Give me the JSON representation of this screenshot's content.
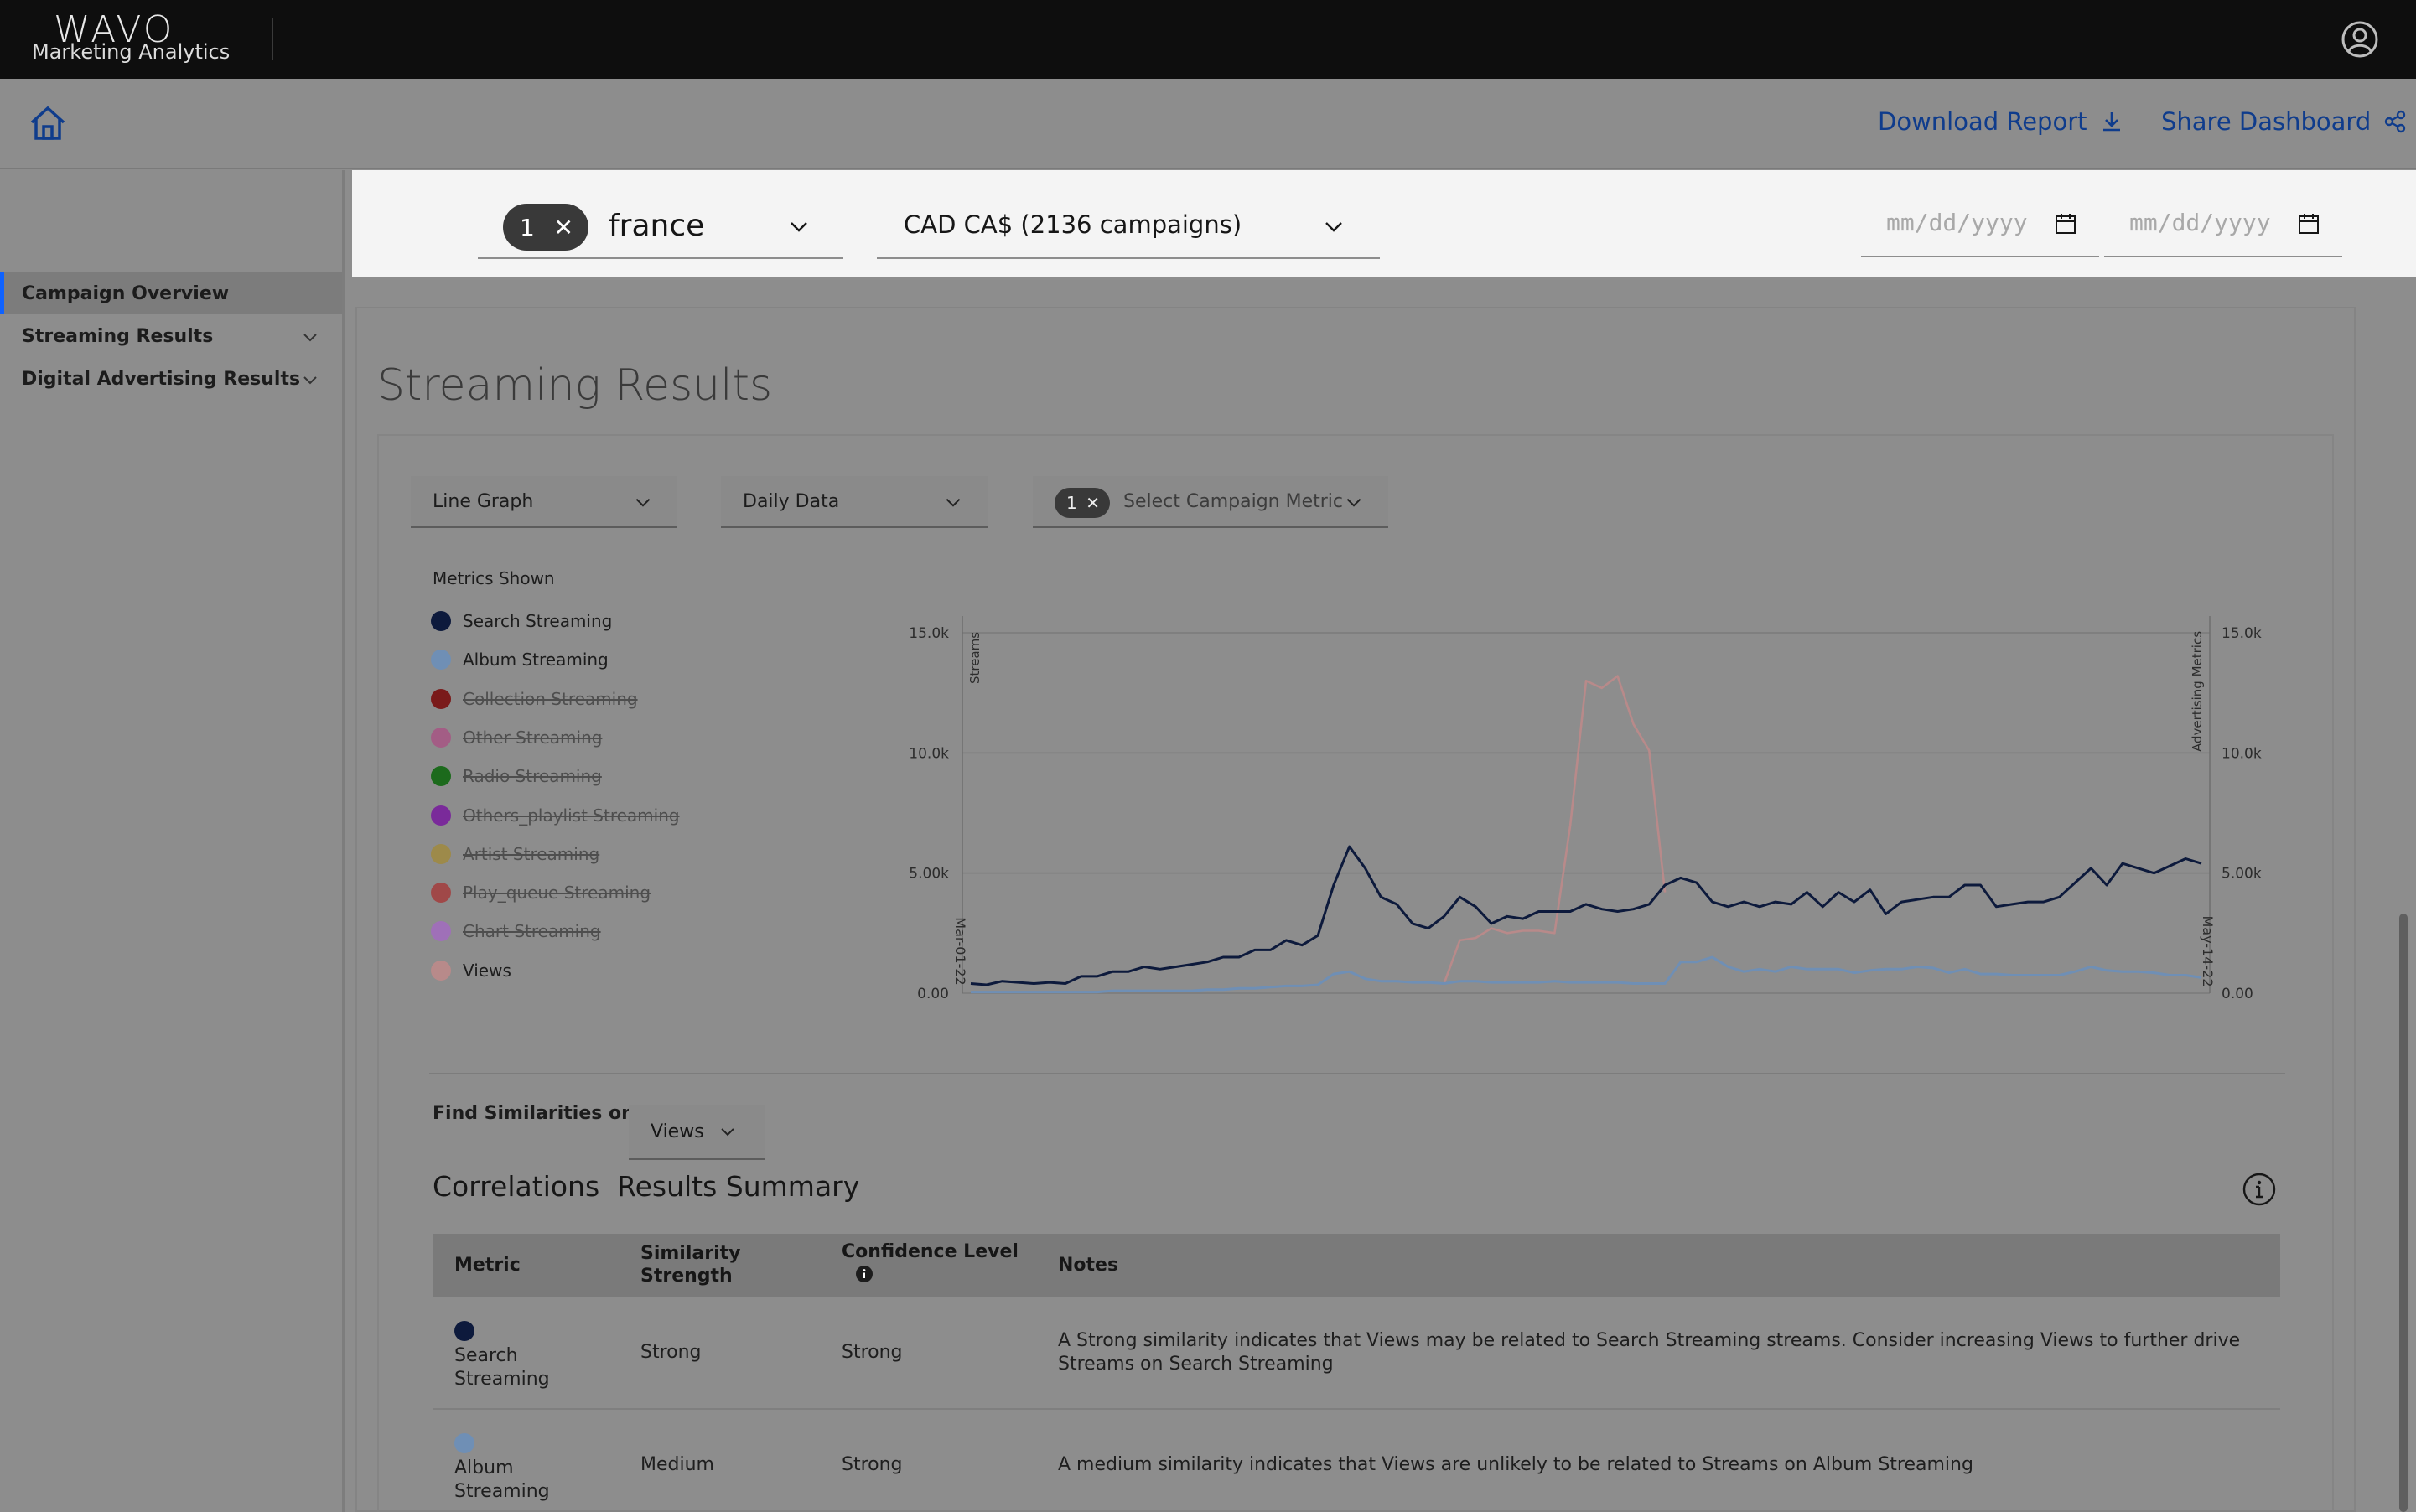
{
  "brand": {
    "logo": "WAVO",
    "subtitle": "Marketing Analytics"
  },
  "header": {
    "download_label": "Download Report",
    "share_label": "Share Dashboard"
  },
  "sidebar": {
    "items": [
      {
        "label": "Campaign Overview",
        "active": true
      },
      {
        "label": "Streaming Results",
        "expandable": true
      },
      {
        "label": "Digital Advertising Results",
        "expandable": true
      }
    ]
  },
  "filters": {
    "country_count": "1",
    "country_value": "france",
    "currency_value": "CAD CA$ (2136 campaigns)",
    "start_date_placeholder": "mm/dd/yyyy",
    "end_date_placeholder": "mm/dd/yyyy"
  },
  "section": {
    "title": "Streaming Results",
    "graph_type": "Line Graph",
    "data_granularity": "Daily Data",
    "metric_count": "1",
    "metric_placeholder": "Select Campaign Metric"
  },
  "legend": {
    "title": "Metrics Shown",
    "items": [
      {
        "label": "Search Streaming",
        "color": "#0d1a3c",
        "enabled": true
      },
      {
        "label": "Album Streaming",
        "color": "#6f8fb5",
        "enabled": true
      },
      {
        "label": "Collection Streaming",
        "color": "#7a1a1a",
        "enabled": false
      },
      {
        "label": "Other Streaming",
        "color": "#a35d85",
        "enabled": false
      },
      {
        "label": "Radio Streaming",
        "color": "#1c6a1c",
        "enabled": false
      },
      {
        "label": "Others_playlist Streaming",
        "color": "#7a2a9a",
        "enabled": false
      },
      {
        "label": "Artist Streaming",
        "color": "#9d8a4a",
        "enabled": false
      },
      {
        "label": "Play_queue Streaming",
        "color": "#a04848",
        "enabled": false
      },
      {
        "label": "Chart Streaming",
        "color": "#9f70b8",
        "enabled": false
      },
      {
        "label": "Views",
        "color": "#b88a8a",
        "enabled": true
      }
    ]
  },
  "chart_data": {
    "type": "line",
    "ylabel_left": "Streams",
    "ylabel_right": "Advertising Metrics",
    "ylim": [
      0,
      15000
    ],
    "y_ticks": [
      "0.00",
      "5.00k",
      "10.0k",
      "15.0k"
    ],
    "x_start_label": "Mar-01-22",
    "x_end_label": "May-14-22",
    "series": [
      {
        "name": "Search Streaming",
        "color": "#0d1a3c",
        "axis": "left",
        "values": [
          400,
          350,
          500,
          450,
          400,
          450,
          400,
          700,
          700,
          900,
          900,
          1100,
          1000,
          1100,
          1200,
          1300,
          1500,
          1500,
          1800,
          1800,
          2200,
          2000,
          2400,
          4500,
          6100,
          5200,
          4000,
          3700,
          2900,
          2700,
          3200,
          4000,
          3600,
          2900,
          3200,
          3100,
          3400,
          3400,
          3400,
          3700,
          3500,
          3400,
          3500,
          3700,
          4500,
          4800,
          4600,
          3800,
          3600,
          3800,
          3600,
          3800,
          3700,
          4200,
          3600,
          4200,
          3800,
          4300,
          3300,
          3800,
          3900,
          4000,
          4000,
          4500,
          4500,
          3600,
          3700,
          3800,
          3800,
          4000,
          4600,
          5200,
          4500,
          5400,
          5200,
          5000,
          5300,
          5600,
          5400
        ]
      },
      {
        "name": "Album Streaming",
        "color": "#6f8fb5",
        "axis": "left",
        "values": [
          50,
          50,
          50,
          50,
          50,
          50,
          50,
          50,
          50,
          100,
          100,
          100,
          100,
          100,
          100,
          150,
          150,
          200,
          200,
          250,
          300,
          300,
          350,
          800,
          900,
          600,
          500,
          500,
          450,
          450,
          400,
          500,
          500,
          450,
          450,
          450,
          450,
          500,
          450,
          450,
          450,
          450,
          400,
          400,
          400,
          1300,
          1300,
          1500,
          1100,
          900,
          1000,
          900,
          1100,
          1000,
          1000,
          1000,
          850,
          950,
          1000,
          1000,
          1100,
          1050,
          850,
          1000,
          800,
          800,
          750,
          750,
          750,
          750,
          900,
          1100,
          950,
          900,
          900,
          850,
          750,
          750,
          650
        ]
      },
      {
        "name": "Views",
        "color": "#b88a8a",
        "axis": "right",
        "values": [
          null,
          null,
          null,
          null,
          null,
          null,
          null,
          null,
          null,
          null,
          null,
          null,
          null,
          null,
          null,
          null,
          null,
          null,
          null,
          null,
          null,
          null,
          null,
          null,
          null,
          null,
          null,
          null,
          null,
          null,
          400,
          2200,
          2300,
          2700,
          2500,
          2600,
          2600,
          2500,
          7000,
          13000,
          12700,
          13200,
          11200,
          10100,
          4200
        ]
      }
    ]
  },
  "similarity": {
    "label": "Find Similarities on",
    "value": "Views"
  },
  "correlations": {
    "title": "Correlations  Results Summary",
    "columns": [
      "Metric",
      "Similarity Strength",
      "Confidence Level",
      "Notes"
    ],
    "rows": [
      {
        "metric": "Search Streaming",
        "color": "#0d1a3c",
        "similarity": "Strong",
        "confidence": "Strong",
        "notes": "A Strong similarity indicates that Views may be related to Search Streaming streams. Consider increasing Views to further drive Streams on Search Streaming"
      },
      {
        "metric": "Album Streaming",
        "color": "#6f8fb5",
        "similarity": "Medium",
        "confidence": "Strong",
        "notes": "A medium similarity indicates that Views are unlikely to be related to Streams on Album Streaming"
      }
    ]
  }
}
